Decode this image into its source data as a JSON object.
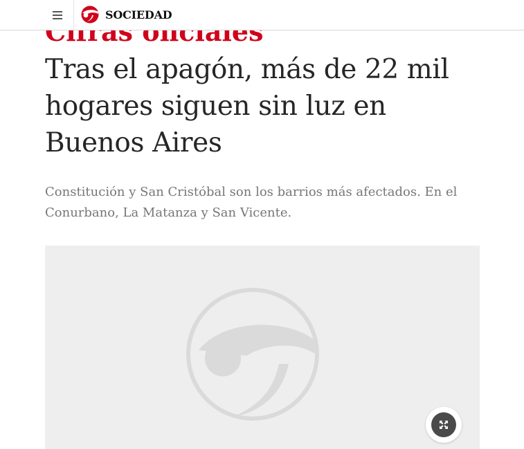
{
  "header": {
    "section_name": "SOCIEDAD",
    "menu_icon": "hamburger-menu-icon",
    "logo_icon": "brand-logo-icon"
  },
  "article": {
    "kicker": "Cifras oficiales",
    "headline": "Tras el apagón, más de 22 mil hogares siguen sin luz en Buenos Aires",
    "summary": "Constitución y San Cristóbal son los barrios más afectados. En el Conurbano, La Matanza y San Vicente."
  },
  "media": {
    "placeholder_icon": "brand-placeholder-icon",
    "expand_icon": "expand-icon"
  },
  "colors": {
    "brand_red": "#d0021b",
    "headline": "#262626",
    "summary": "#767676",
    "placeholder_bg": "#eeeeee"
  }
}
